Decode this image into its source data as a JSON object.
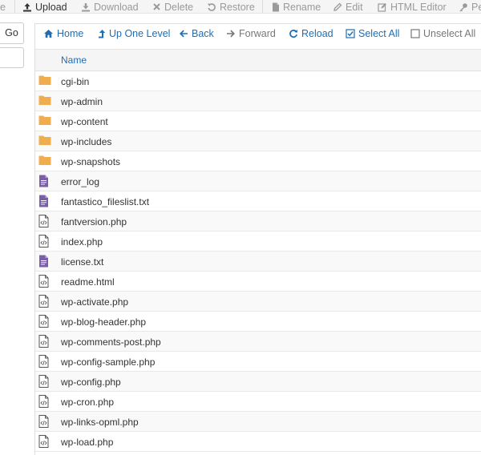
{
  "toolbar": {
    "items": [
      {
        "label": "e",
        "enabled": false
      },
      {
        "label": "Upload",
        "enabled": true
      },
      {
        "label": "Download",
        "enabled": false
      },
      {
        "label": "Delete",
        "enabled": false
      },
      {
        "label": "Restore",
        "enabled": false
      },
      {
        "label": "Rename",
        "enabled": false
      },
      {
        "label": "Edit",
        "enabled": false
      },
      {
        "label": "HTML Editor",
        "enabled": false
      },
      {
        "label": "Pe",
        "enabled": false
      }
    ]
  },
  "left": {
    "go_label": "Go"
  },
  "nav": {
    "home": "Home",
    "up_one_level": "Up One Level",
    "back": "Back",
    "forward": "Forward",
    "reload": "Reload",
    "select_all": "Select All",
    "unselect_all": "Unselect All"
  },
  "table": {
    "header_name": "Name",
    "files": [
      {
        "name": "cgi-bin",
        "type": "folder"
      },
      {
        "name": "wp-admin",
        "type": "folder"
      },
      {
        "name": "wp-content",
        "type": "folder"
      },
      {
        "name": "wp-includes",
        "type": "folder"
      },
      {
        "name": "wp-snapshots",
        "type": "folder"
      },
      {
        "name": "error_log",
        "type": "text"
      },
      {
        "name": "fantastico_fileslist.txt",
        "type": "text"
      },
      {
        "name": "fantversion.php",
        "type": "code"
      },
      {
        "name": "index.php",
        "type": "code"
      },
      {
        "name": "license.txt",
        "type": "text"
      },
      {
        "name": "readme.html",
        "type": "code"
      },
      {
        "name": "wp-activate.php",
        "type": "code"
      },
      {
        "name": "wp-blog-header.php",
        "type": "code"
      },
      {
        "name": "wp-comments-post.php",
        "type": "code"
      },
      {
        "name": "wp-config-sample.php",
        "type": "code"
      },
      {
        "name": "wp-config.php",
        "type": "code"
      },
      {
        "name": "wp-cron.php",
        "type": "code"
      },
      {
        "name": "wp-links-opml.php",
        "type": "code"
      },
      {
        "name": "wp-load.php",
        "type": "code"
      }
    ]
  },
  "colors": {
    "link": "#1e6db5",
    "folder": "#f0ad4e",
    "text_file": "#7a5ea7",
    "code_file": "#555555"
  }
}
